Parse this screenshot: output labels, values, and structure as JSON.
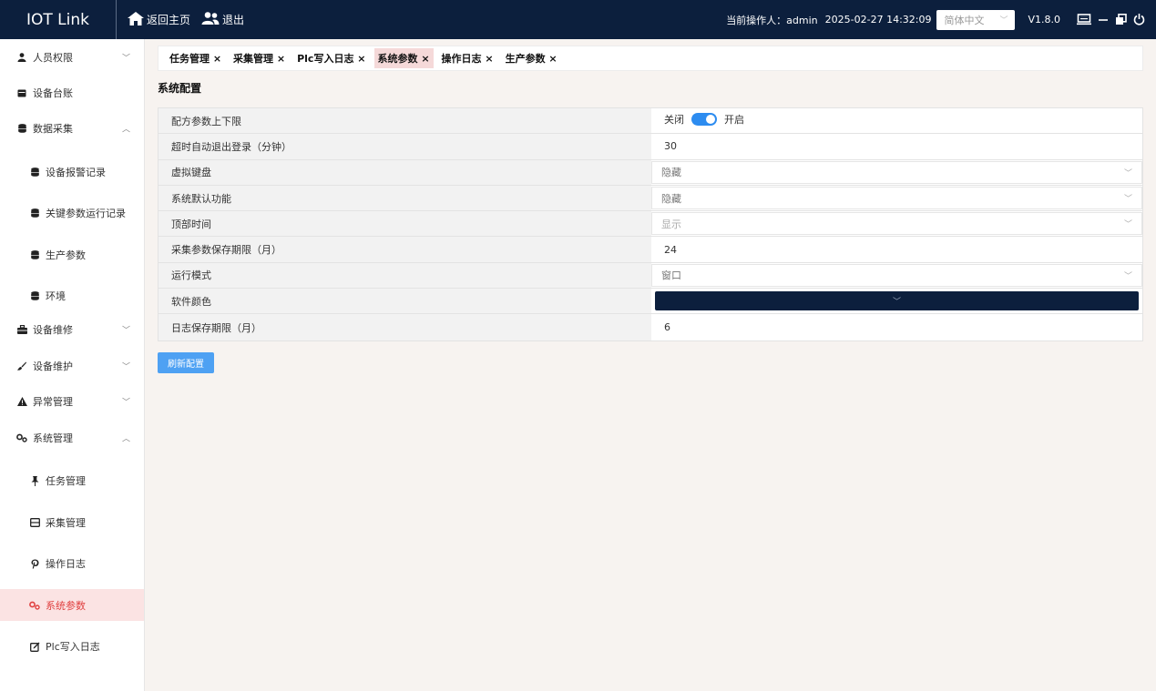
{
  "header": {
    "brand": "IOT Link",
    "home_label": "返回主页",
    "logout_label": "退出",
    "operator_label": "当前操作人：admin",
    "datetime": "2025-02-27 14:32:09",
    "language": "简体中文",
    "version": "V1.8.0"
  },
  "sidebar": {
    "items": [
      {
        "label": "人员权限",
        "icon": "user-icon",
        "chevron": "﹀"
      },
      {
        "label": "设备台账",
        "icon": "card-icon"
      },
      {
        "label": "数据采集",
        "icon": "database-icon",
        "chevron": "︿"
      },
      {
        "label": "设备报警记录",
        "icon": "database-icon"
      },
      {
        "label": "关键参数运行记录",
        "icon": "database-icon"
      },
      {
        "label": "生产参数",
        "icon": "database-icon"
      },
      {
        "label": "环境",
        "icon": "database-icon"
      },
      {
        "label": "设备维修",
        "icon": "toolbox-icon",
        "chevron": "﹀"
      },
      {
        "label": "设备维护",
        "icon": "brush-icon",
        "chevron": "﹀"
      },
      {
        "label": "异常管理",
        "icon": "warning-icon",
        "chevron": "﹀"
      },
      {
        "label": "系统管理",
        "icon": "gears-icon",
        "chevron": "︿"
      },
      {
        "label": "任务管理",
        "icon": "pin-icon"
      },
      {
        "label": "采集管理",
        "icon": "window-icon"
      },
      {
        "label": "操作日志",
        "icon": "pinterest-icon"
      },
      {
        "label": "系统参数",
        "icon": "gears-icon"
      },
      {
        "label": "Plc写入日志",
        "icon": "edit-icon"
      }
    ]
  },
  "tabs": [
    "任务管理 ×",
    "采集管理 ×",
    "Plc写入日志 ×",
    "系统参数 ×",
    "操作日志 ×",
    "生产参数 ×"
  ],
  "section_title": "系统配置",
  "config": {
    "recipe_limit": {
      "label": "配方参数上下限",
      "off": "关闭",
      "on": "开启"
    },
    "timeout": {
      "label": "超时自动退出登录（分钟）",
      "value": "30"
    },
    "virtual_keyboard": {
      "label": "虚拟键盘",
      "value": "隐藏"
    },
    "default_function": {
      "label": "系统默认功能",
      "value": "隐藏"
    },
    "top_time": {
      "label": "顶部时间",
      "value": "显示"
    },
    "collect_retention": {
      "label": "采集参数保存期限（月）",
      "value": "24"
    },
    "run_mode": {
      "label": "运行模式",
      "value": "窗口"
    },
    "software_color": {
      "label": "软件颜色",
      "value": "#0c1f3d"
    },
    "log_retention": {
      "label": "日志保存期限（月）",
      "value": "6"
    }
  },
  "refresh_button": "刷新配置",
  "colors": {
    "header_bg": "#0c1f3d",
    "accent": "#2d8cf0",
    "active_menu_bg": "#fbe3e3",
    "active_menu_text": "#e04040"
  }
}
